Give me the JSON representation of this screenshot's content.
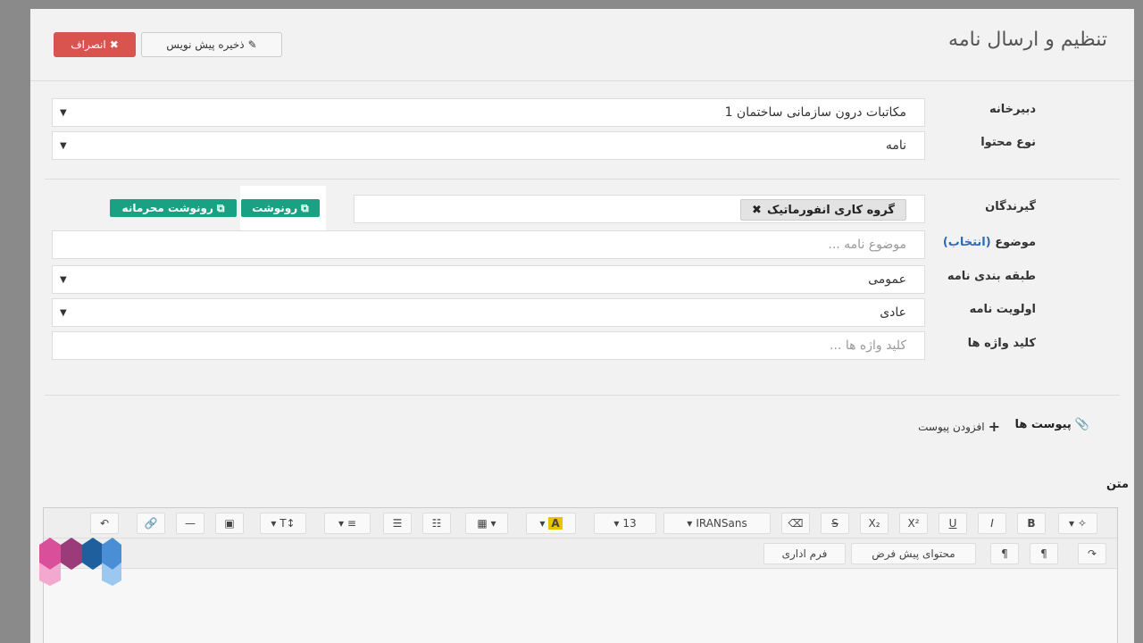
{
  "header": {
    "title": "تنظیم و ارسال نامه",
    "cancel_label": "انصراف",
    "draft_label": "ذخیره پیش نویس"
  },
  "form": {
    "secretariat_label": "دبیرخانه",
    "secretariat_value": "مکاتبات درون سازمانی ساختمان 1",
    "content_type_label": "نوع محتوا",
    "content_type_value": "نامه",
    "recipients_label": "گیرندگان",
    "recipient_chip": "گروه کاری انفورماتیک",
    "cc_button": "رونوشت",
    "confidential_cc_button": "رونوشت محرمانه",
    "subject_label": "موضوع",
    "subject_choose": "(انتخاب)",
    "subject_placeholder": "موضوع نامه ...",
    "classification_label": "طبقه بندی نامه",
    "classification_value": "عمومی",
    "priority_label": "اولویت نامه",
    "priority_value": "عادی",
    "keywords_label": "کلید واژه ها",
    "keywords_placeholder": "کلید واژه ها ..."
  },
  "attachments": {
    "label": "پیوست ها",
    "add_label": "افزودن پیوست"
  },
  "editor": {
    "label": "متن",
    "font_name": "IRANSans",
    "font_size": "13",
    "default_content_button": "محتوای پیش فرض",
    "office_form_button": "فرم اداری"
  }
}
